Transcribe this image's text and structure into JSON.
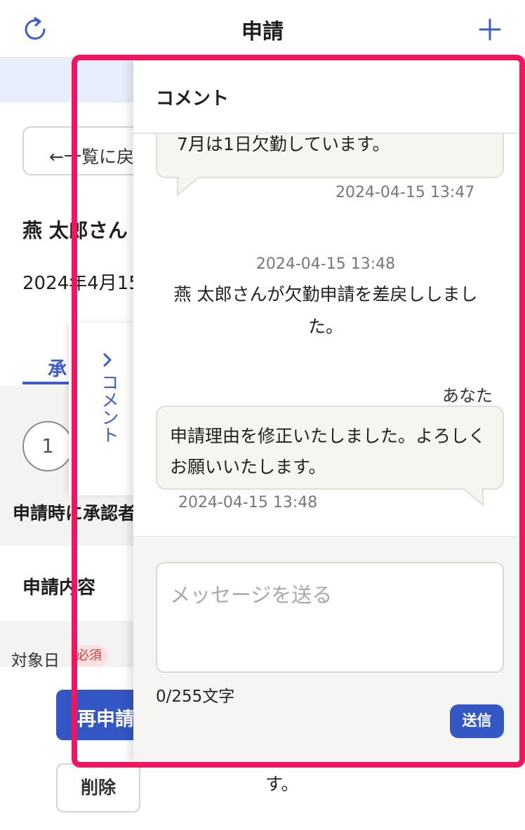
{
  "header": {
    "title": "申請",
    "left_icon": "refresh-icon",
    "right_icon": "plus-icon",
    "accent": "#3b5bd0"
  },
  "background": {
    "back_button_label": "←一覧に戻",
    "applicant_name": "燕 太郎さん",
    "applied_date": "2024年4月15",
    "tab_label": "承",
    "step_number": "1",
    "approver_label": "申請時に承認者",
    "content_heading": "申請内容",
    "target_date_label": "対象日",
    "required_badge": "必須",
    "reapply_button_label": "再申請",
    "delete_button_label": "削除",
    "trailing_text": "す。"
  },
  "collapse_tab": {
    "label": "コメント",
    "icon": "chevron-right-icon"
  },
  "comments": {
    "title": "コメント",
    "messages": [
      {
        "text": "7月は1日欠勤しています。",
        "timestamp": "2024-04-15 13:47"
      },
      {
        "timestamp": "2024-04-15 13:48",
        "text": "燕 太郎さんが欠勤申請を差戻ししました。"
      },
      {
        "sender": "あなた",
        "text": "申請理由を修正いたしました。よろしくお願いいたします。",
        "timestamp": "2024-04-15 13:48"
      }
    ],
    "composer": {
      "value": "",
      "placeholder": "メッセージを送る",
      "char_count": "0/255文字",
      "send_label": "送信"
    }
  },
  "colors": {
    "primary_button": "#3457c6",
    "highlight_frame": "#f2145e",
    "bubble_bg": "#f6f5f0"
  }
}
